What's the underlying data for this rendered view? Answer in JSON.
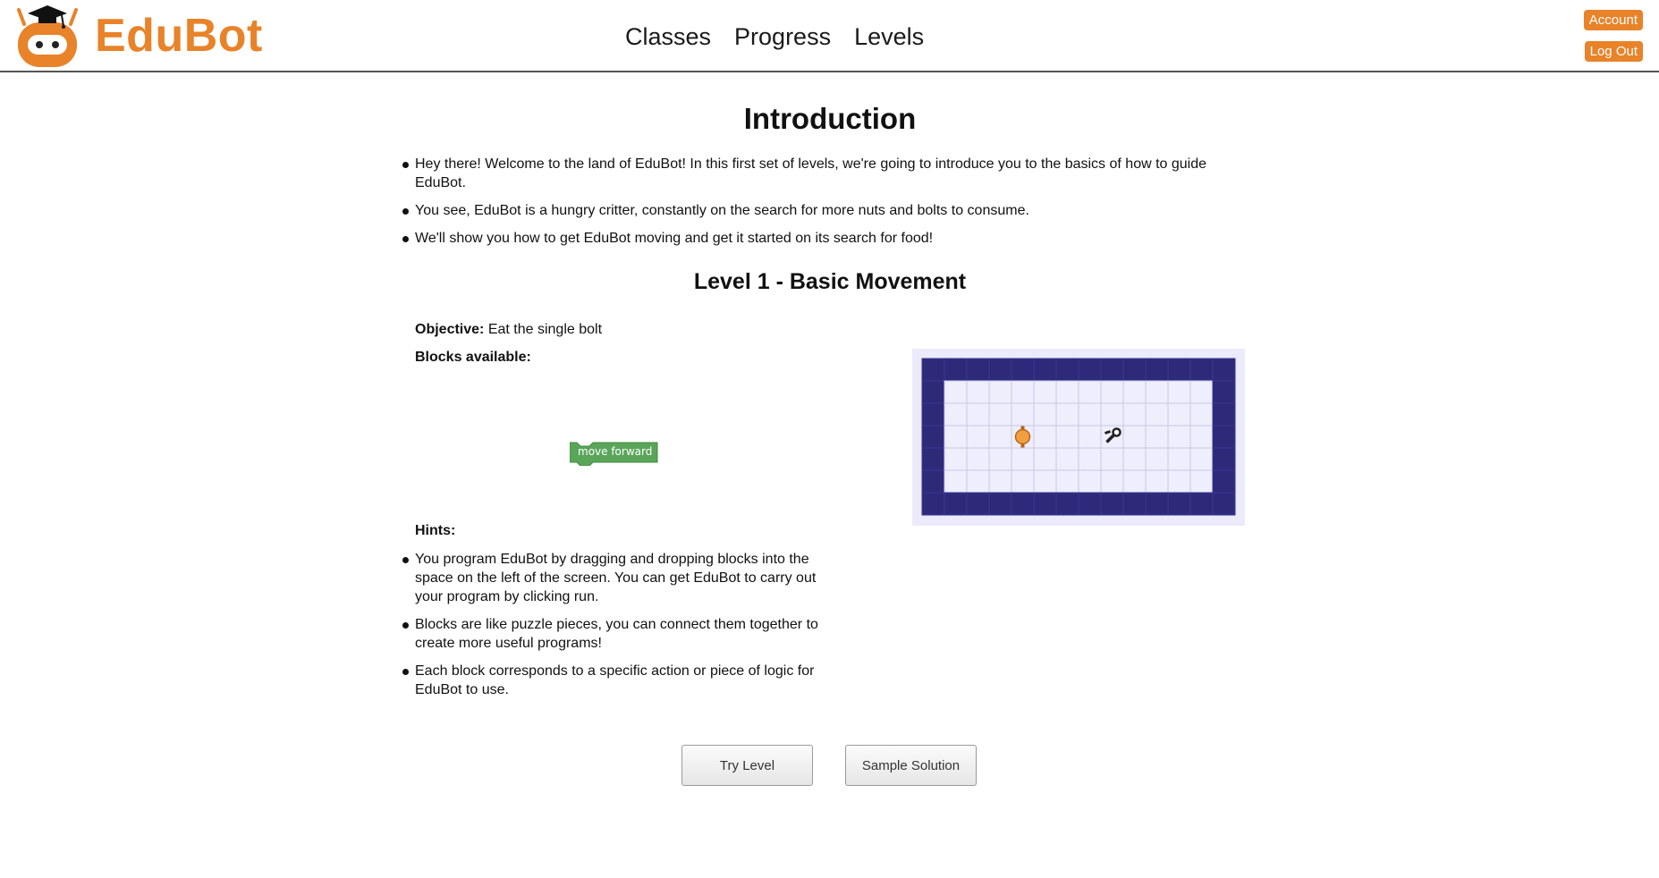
{
  "app": {
    "brand": "EduBot"
  },
  "nav": {
    "items": [
      "Classes",
      "Progress",
      "Levels"
    ]
  },
  "account": {
    "account_label": "Account",
    "logout_label": "Log Out"
  },
  "intro": {
    "title": "Introduction",
    "bullets": [
      "Hey there! Welcome to the land of EduBot! In this first set of levels, we're going to introduce you to the basics of how to guide EduBot.",
      "You see, EduBot is a hungry critter, constantly on the search for more nuts and bolts to consume.",
      "We'll show you how to get EduBot moving and get it started on its search for food!"
    ]
  },
  "level": {
    "title": "Level 1 - Basic Movement",
    "objective_label": "Objective:",
    "objective_text": "Eat the single bolt",
    "blocks_label": "Blocks available:",
    "block_name": "move forward",
    "hints_label": "Hints:",
    "hints": [
      "You program EduBot by dragging and dropping blocks into the space on the left of the screen. You can get EduBot to carry out your program by clicking run.",
      "Blocks are like puzzle pieces, you can connect them together to create more useful programs!",
      "Each block corresponds to a specific action or piece of logic for EduBot to use."
    ]
  },
  "actions": {
    "try_label": "Try Level",
    "solution_label": "Sample Solution"
  },
  "colors": {
    "brand": "#e8832a",
    "block_green": "#5ba55b",
    "wall": "#2e2a7a",
    "floor": "#eeeefc"
  },
  "icons": {
    "logo": "edubot-mascot-icon",
    "robot": "robot-icon",
    "bolt": "bolt-icon"
  }
}
